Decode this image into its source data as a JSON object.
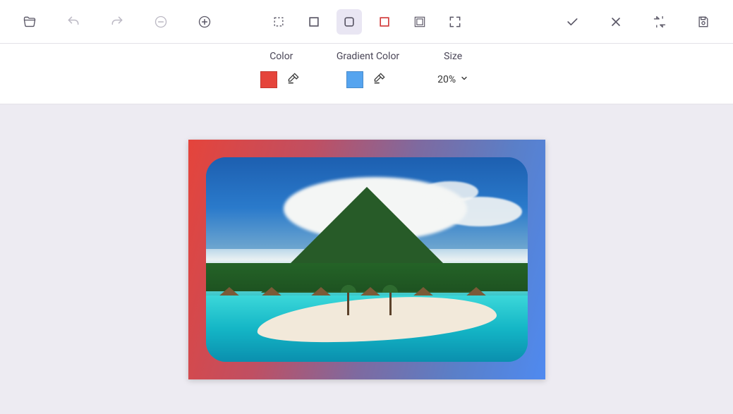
{
  "toolbar": {
    "left": [
      "open",
      "undo",
      "redo",
      "remove",
      "add"
    ],
    "center": [
      "crop-free",
      "border-solid",
      "border-rounded",
      "border-outline",
      "border-double",
      "fit-screen"
    ],
    "right": [
      "apply",
      "cancel",
      "compare",
      "save"
    ],
    "selected_center": "border-rounded",
    "disabled": [
      "undo",
      "redo",
      "remove"
    ]
  },
  "options": {
    "color": {
      "label": "Color",
      "value": "#e5443b"
    },
    "gradient_color": {
      "label": "Gradient Color",
      "value": "#55a4ef"
    },
    "size": {
      "label": "Size",
      "value": "20%"
    }
  },
  "frame": {
    "border_size_pct": 20,
    "corner_radius_px": 28,
    "gradient_from": "#e5443b",
    "gradient_to": "#4f8af0"
  }
}
